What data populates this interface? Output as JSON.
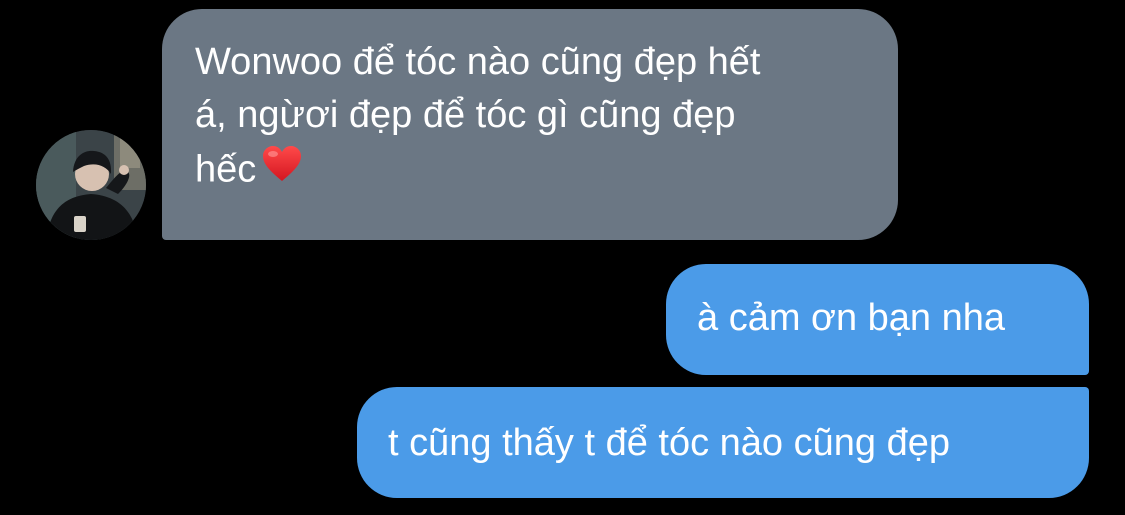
{
  "conversation": {
    "incoming": {
      "avatar_icon": "profile-photo-avatar",
      "lines": [
        "Wonwoo để tóc nào cũng đẹp hết",
        "á, ngừơi đẹp để tóc gì cũng đẹp",
        "hếc"
      ],
      "emoji": "red-heart-icon",
      "bubble_color": "#6b7784"
    },
    "outgoing": [
      {
        "text": "à cảm ơn bạn nha"
      },
      {
        "text": "t cũng thấy t để tóc nào cũng đẹp"
      }
    ],
    "outgoing_color": "#4b9be8",
    "background": "#000000"
  }
}
